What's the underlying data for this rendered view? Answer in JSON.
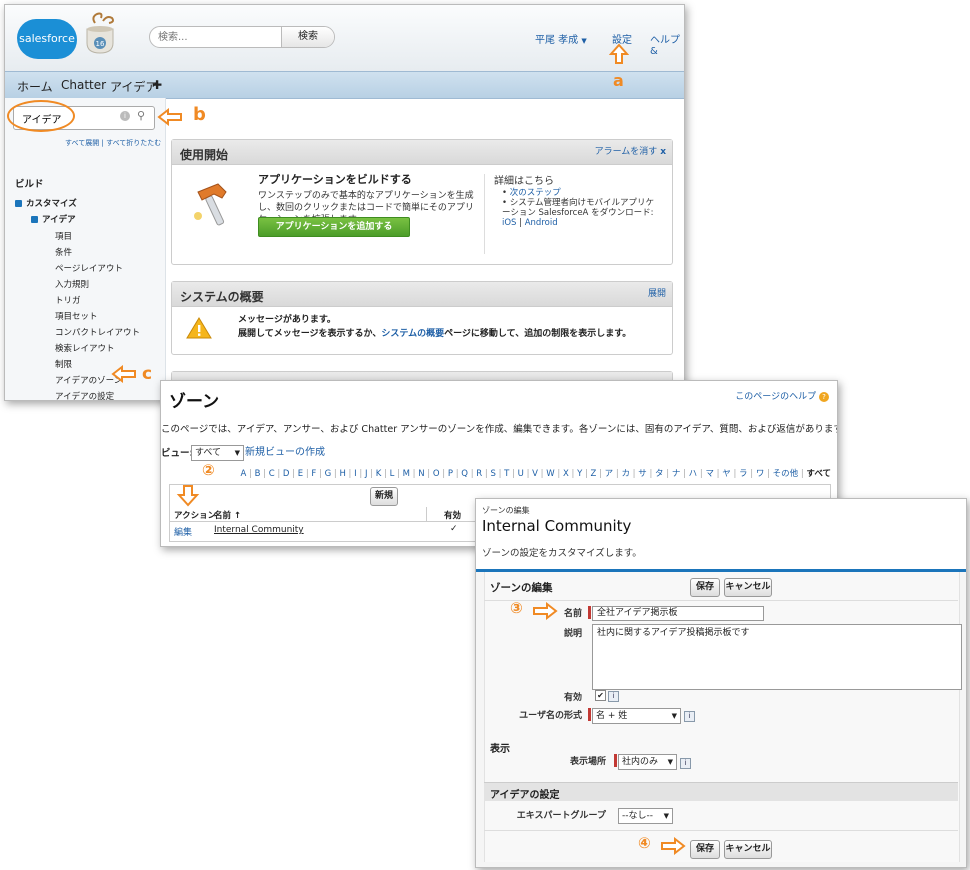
{
  "colors": {
    "accent": "#f08a24",
    "brand": "#1b8fd6",
    "link": "#1e5fa6",
    "required": "#c23934",
    "green_button": "#5aa832"
  },
  "panel1": {
    "header": {
      "logo": "salesforce",
      "mascot_badge": "16",
      "search_placeholder": "検索...",
      "search_button": "検索",
      "user_menu": "平尾 孝成",
      "setup_link": "設定",
      "help_link": "ヘルプ &"
    },
    "tabs": [
      "ホーム",
      "Chatter",
      "アイデア"
    ],
    "plus_tab": "✚",
    "sidebar": {
      "quickfind_value": "アイデア",
      "expand_all": "すべて展開",
      "separator": "|",
      "collapse_all": "すべて折りたたむ",
      "section": "ビルド",
      "items": [
        {
          "label": "カスタマイズ",
          "level": 0
        },
        {
          "label": "アイデア",
          "level": 1
        },
        {
          "label": "項目",
          "level": 2
        },
        {
          "label": "条件",
          "level": 2
        },
        {
          "label": "ページレイアウト",
          "level": 2
        },
        {
          "label": "入力規則",
          "level": 2
        },
        {
          "label": "トリガ",
          "level": 2
        },
        {
          "label": "項目セット",
          "level": 2
        },
        {
          "label": "コンパクトレイアウト",
          "level": 2
        },
        {
          "label": "検索レイアウト",
          "level": 2
        },
        {
          "label": "制限",
          "level": 2
        },
        {
          "label": "アイデアのゾーン",
          "level": 2
        },
        {
          "label": "アイデアの設定",
          "level": 2
        }
      ]
    },
    "getting_started": {
      "title": "使用開始",
      "dismiss_link": "アラームを消す",
      "dismiss_x": "x",
      "heading": "アプリケーションをビルドする",
      "body": "ワンステップのみで基本的なアプリケーションを生成し、数回のクリックまたはコードで簡単にそのアプリケーションを拡張します。",
      "button": "アプリケーションを追加する",
      "details_title": "詳細はこちら",
      "bullet1": "次のステップ",
      "bullet2_prefix": "システム管理者向けモバイルアプリケーション SalesforceA をダウンロード: ",
      "ios": "iOS",
      "sep": " | ",
      "android": "Android"
    },
    "overview": {
      "title": "システムの概要",
      "expand_link": "展開",
      "message_title": "メッセージがあります。",
      "message_prefix": "展開してメッセージを表示するか、",
      "message_link": "システムの概要",
      "message_suffix": "ページに移動して、追加の制限を表示します。"
    },
    "callout_a": "a",
    "callout_b": "b",
    "callout_c": "c"
  },
  "panel2": {
    "title": "ゾーン",
    "help_link": "このページのヘルプ",
    "description": "このページでは、アイデア、アンサー、および Chatter アンサーのゾーンを作成、編集できます。各ゾーンには、固有のアイデア、質問、および返信があります。",
    "view_label": "ビュー:",
    "view_value": "すべて",
    "new_view_link": "新規ビューの作成",
    "alphabet": [
      "A",
      "B",
      "C",
      "D",
      "E",
      "F",
      "G",
      "H",
      "I",
      "J",
      "K",
      "L",
      "M",
      "N",
      "O",
      "P",
      "Q",
      "R",
      "S",
      "T",
      "U",
      "V",
      "W",
      "X",
      "Y",
      "Z",
      "ア",
      "カ",
      "サ",
      "タ",
      "ナ",
      "ハ",
      "マ",
      "ヤ",
      "ラ",
      "ワ",
      "その他"
    ],
    "alphabet_all": "すべて",
    "new_button": "新規",
    "columns": [
      "アクション",
      "名前 ↑",
      "有効"
    ],
    "rows": [
      {
        "action": "編集",
        "name": "Internal Community",
        "active": "✓"
      }
    ],
    "callout_2": "②"
  },
  "panel3": {
    "breadcrumb": "ゾーンの編集",
    "title": "Internal Community",
    "subtitle": "ゾーンの設定をカスタマイズします。",
    "section_title": "ゾーンの編集",
    "save_button": "保存",
    "cancel_button": "キャンセル",
    "name_label": "名前",
    "name_value": "全社アイデア掲示板",
    "desc_label": "説明",
    "desc_value": "社内に関するアイデア投稿掲示板です",
    "active_label": "有効",
    "active_check": "✔",
    "username_label": "ユーザ名の形式",
    "username_value": "名 + 姓",
    "display_section": "表示",
    "display_label": "表示場所",
    "display_value": "社内のみ",
    "idea_settings_title": "アイデアの設定",
    "expert_label": "エキスパートグループ",
    "expert_value": "--なし--",
    "info_glyph": "i",
    "callout_3": "③",
    "callout_4": "④"
  }
}
